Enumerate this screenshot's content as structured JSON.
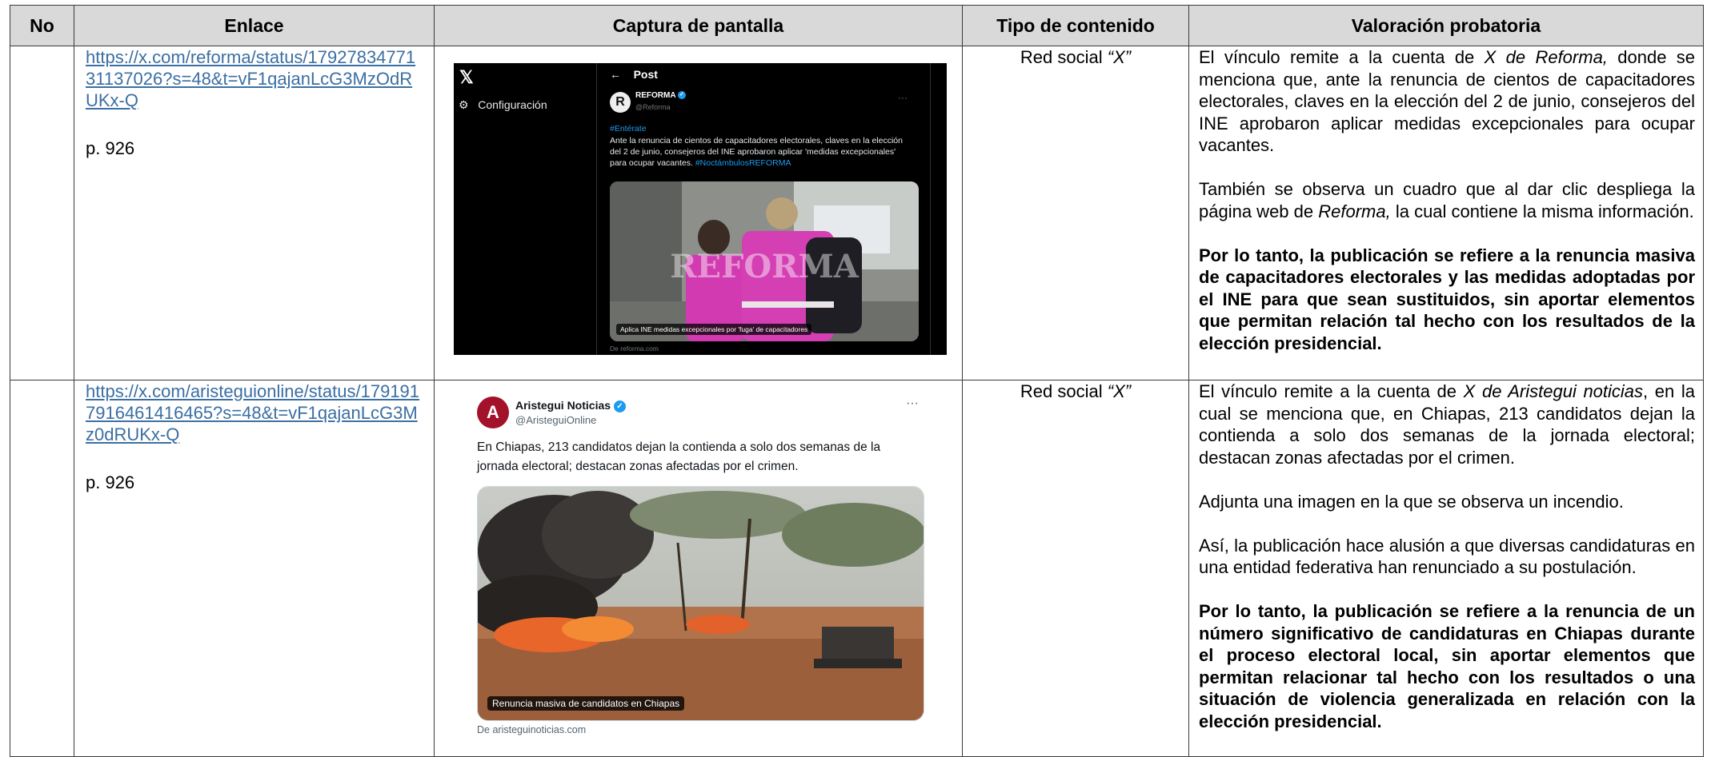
{
  "table": {
    "headers": [
      "No",
      "Enlace",
      "Captura de pantalla",
      "Tipo de contenido",
      "Valoración probatoria"
    ],
    "rows": [
      {
        "no": "",
        "link": "https://x.com/reforma/status/1792783477131137026?s=48&t=vF1qajanLcG3MzOdRUKx-Q",
        "page": "p. 926",
        "type_prefix": "Red social ",
        "type_italic": "“X”",
        "valuation": {
          "p1_pre": "El vínculo remite a la cuenta de ",
          "p1_em": "X de Reforma,",
          "p1_post": " donde se menciona que, ante la renuncia de cientos de capacitadores electorales, claves en la elección del 2 de junio, consejeros del INE aprobaron aplicar medidas excepcionales para ocupar vacantes.",
          "p2_pre": "También se observa un cuadro que al dar clic despliega la página web de ",
          "p2_em": "Reforma,",
          "p2_post": " la cual contiene la misma información.",
          "p3": "Por lo tanto, la publicación se refiere a la renuncia masiva de capacitadores electorales y las medidas adoptadas por el INE para que sean sustituidos, sin aportar elementos que permitan relación tal hecho con los resultados de la elección presidencial."
        },
        "screenshot": {
          "sidebar_item": "Configuración",
          "header": "Post",
          "account_name": "REFORMA",
          "handle": "@Reforma",
          "tag": "#Entérate",
          "text": "Ante la renuncia de cientos de capacitadores electorales, claves en la elección del 2 de junio, consejeros del INE  aprobaron aplicar 'medidas excepcionales' para ocupar vacantes. ",
          "hashtag": "#NoctámbulosREFORMA",
          "image_caption": "Aplica INE medidas excepcionales por 'fuga' de capacitadores",
          "watermark": "REFORMA",
          "source": "De reforma.com"
        }
      },
      {
        "no": "",
        "link": "https://x.com/aristeguionline/status/1791917916461416465?s=48&t=vF1qajanLcG3Mz0dRUKx-Q",
        "page": "p. 926",
        "type_prefix": "Red social ",
        "type_italic": "“X”",
        "valuation": {
          "p1_pre": "El vínculo remite a la cuenta de ",
          "p1_em": "X de Aristegui noticias",
          "p1_post": ", en la cual se menciona que, en Chiapas, 213 candidatos dejan la contienda a solo dos semanas de la jornada electoral; destacan zonas afectadas por el crimen.",
          "p2": "Adjunta una imagen en la que se observa un incendio.",
          "p3": "Así, la publicación hace alusión a que diversas candidaturas en una entidad federativa han renunciado a su postulación.",
          "p4": "Por lo tanto, la publicación se refiere a la renuncia de un número significativo de candidaturas en Chiapas durante el proceso electoral local, sin aportar elementos que permitan relacionar tal hecho con los resultados o una situación de violencia generalizada en relación con la elección presidencial."
        },
        "screenshot": {
          "account_name": "Aristegui Noticias",
          "handle": "@AristeguiOnline",
          "text": "En Chiapas, 213 candidatos dejan la contienda a solo dos semanas de la jornada electoral; destacan zonas afectadas por el crimen.",
          "image_caption": "Renuncia masiva de candidatos en Chiapas",
          "source": "De aristeguinoticias.com"
        }
      }
    ]
  }
}
